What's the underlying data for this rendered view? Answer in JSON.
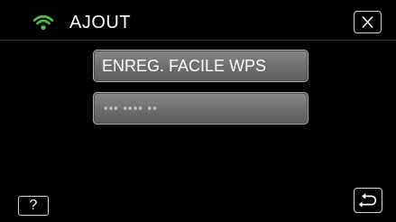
{
  "header": {
    "title": "AJOUT",
    "wifi_icon": "wifi-icon",
    "close_icon": "close-icon"
  },
  "options": [
    {
      "label": "ENREG. FACILE WPS"
    },
    {
      "label": "▪▪▪ ▪▪▪▪ ▪▪",
      "masked": true
    }
  ],
  "footer": {
    "help_label": "?",
    "back_icon": "return-arrow-icon"
  },
  "colors": {
    "background": "#000000",
    "text": "#ffffff",
    "wifi": "#4fc04a",
    "button_fill": "#737373",
    "button_border": "#d8d8d8"
  }
}
